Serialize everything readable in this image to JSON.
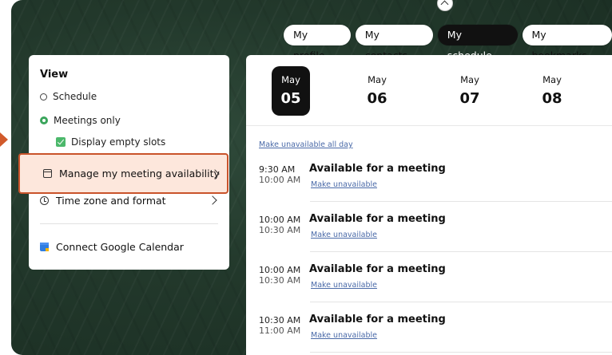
{
  "nav": {
    "tabs": [
      {
        "label": "My profile"
      },
      {
        "label": "My contacts"
      },
      {
        "label": "My schedule",
        "active": true
      },
      {
        "label": "My bookmarks"
      }
    ]
  },
  "view_panel": {
    "title": "View",
    "options": [
      {
        "label": "Schedule",
        "selected": false
      },
      {
        "label": "Meetings only",
        "selected": true
      }
    ],
    "display_empty_slots": {
      "label": "Display empty slots",
      "checked": true
    },
    "manage_availability": {
      "label": "Manage my meeting availability"
    },
    "time_zone": {
      "label": "Time zone and format"
    },
    "connect_calendar": {
      "label": "Connect Google Calendar"
    }
  },
  "schedule": {
    "days": [
      {
        "month": "May",
        "day": "05",
        "selected": true
      },
      {
        "month": "May",
        "day": "06",
        "selected": false
      },
      {
        "month": "May",
        "day": "07",
        "selected": false
      },
      {
        "month": "May",
        "day": "08",
        "selected": false
      }
    ],
    "make_unavailable_all_day": "Make unavailable all day",
    "slots": [
      {
        "start": "9:30 AM",
        "end": "10:00 AM",
        "title": "Available for a meeting",
        "action": "Make unavailable"
      },
      {
        "start": "10:00 AM",
        "end": "10:30 AM",
        "title": "Available for a meeting",
        "action": "Make unavailable"
      },
      {
        "start": "10:00 AM",
        "end": "10:30 AM",
        "title": "Available for a meeting",
        "action": "Make unavailable"
      },
      {
        "start": "10:30 AM",
        "end": "11:00 AM",
        "title": "Available for a meeting",
        "action": "Make unavailable"
      }
    ]
  },
  "colors": {
    "highlight_border": "#c9532a",
    "highlight_fill": "#fde7dc",
    "active_tab": "#111111",
    "accent_green": "#3aa55b",
    "link": "#4a6aa8"
  }
}
